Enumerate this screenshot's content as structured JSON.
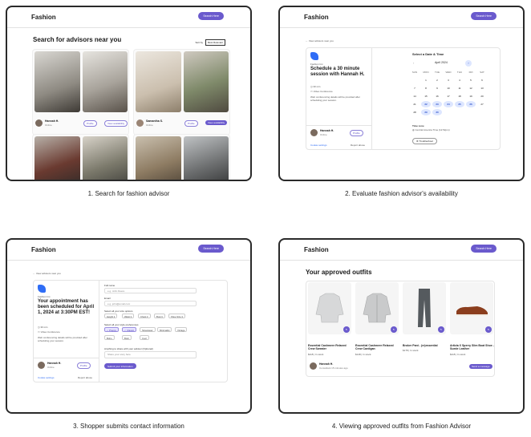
{
  "captions": [
    "1. Search for fashion advisor",
    "2. Evaluate fashion advisor's availability",
    "3. Shopper submits contact information",
    "4. Viewing approved outfits from Fashion Advisor"
  ],
  "nav": {
    "brand": "Fashion",
    "search_button": "Search Here"
  },
  "panel1": {
    "title": "Search for advisors near you",
    "sort_label": "Sort by",
    "sort_value": "Most Relevant",
    "advisors": [
      {
        "name": "Hannah H.",
        "location": "Online",
        "profile": "Profile",
        "availability": "View availability"
      },
      {
        "name": "Samantha S.",
        "location": "Online",
        "profile": "Profile",
        "availability": "View availability"
      }
    ]
  },
  "panel2": {
    "back": "View advisors near you",
    "company": "Fashion Inc.",
    "title": "Schedule a 30 minute session with Hannah H.",
    "duration": "30 min",
    "meeting": "Video Conference",
    "details": "Web conferencing details will be provided after scheduling your session.",
    "advisor": "Hannah H.",
    "advisor_sub": "Online",
    "profile": "Profile",
    "footer_left": "Cookie settings",
    "footer_right": "Report abuse",
    "cal_heading": "Select a Date & Time",
    "month": "April 2024",
    "weekdays": [
      "SUN",
      "MON",
      "TUE",
      "WED",
      "THU",
      "FRI",
      "SAT"
    ],
    "timezone_label": "Time zone",
    "timezone_value": "Central America Time (12:52pm)",
    "troubleshoot": "Troubleshoot"
  },
  "panel3": {
    "back": "View advisors near you",
    "company": "Fashion Inc.",
    "title": "Your appointment has been scheduled for April 1, 2024 at 3:30PM EST!",
    "duration": "30 min",
    "meeting": "Video Conference",
    "details": "Web conferencing details will be provided after scheduling your session.",
    "advisor": "Hannah H.",
    "advisor_sub": "Online",
    "profile": "Profile",
    "footer_left": "Cookie settings",
    "footer_right": "Report abuse",
    "full_name_label": "Full name",
    "full_name_ph": "e.g. John Deere",
    "email_label": "Email",
    "email_ph": "e.g. john@email.com",
    "size_label": "Select all your size options",
    "sizes": [
      "Height",
      "Waist",
      "Chest",
      "Bust",
      "Shoe Size"
    ],
    "styles_label": "Select all your style preferences",
    "styles": [
      "Preppy",
      "Classic",
      "Streetwear",
      "Minimalist",
      "Vintage",
      "Boho",
      "Bold",
      "Cool"
    ],
    "selected_styles": [
      "Preppy",
      "Classic"
    ],
    "notes_label": "Anything to share with your advisor (Optional)",
    "notes_ph": "Share your story here",
    "submit": "Submit your information"
  },
  "panel4": {
    "title": "Your approved outfits",
    "products": [
      {
        "name": "Essential Cashmere Relaxed Crew Sweater",
        "price": "$118 | In stock"
      },
      {
        "name": "Essential Cashmere Relaxed Crew Cardigan",
        "price": "$148 | In stock"
      },
      {
        "name": "Broker Pant - (re)essential",
        "price": "$178 | In stock"
      },
      {
        "name": "Artizia X Sperry Slim Boat Shoe - Suede Leather",
        "price": "$118 | In stock"
      }
    ],
    "advisor": "Hannah H.",
    "advisor_sub": "Consultant 15 minutes ago",
    "message_button": "Send a message"
  },
  "colors": {
    "accent": "#6a5acd",
    "logo": "#2f6df6"
  }
}
